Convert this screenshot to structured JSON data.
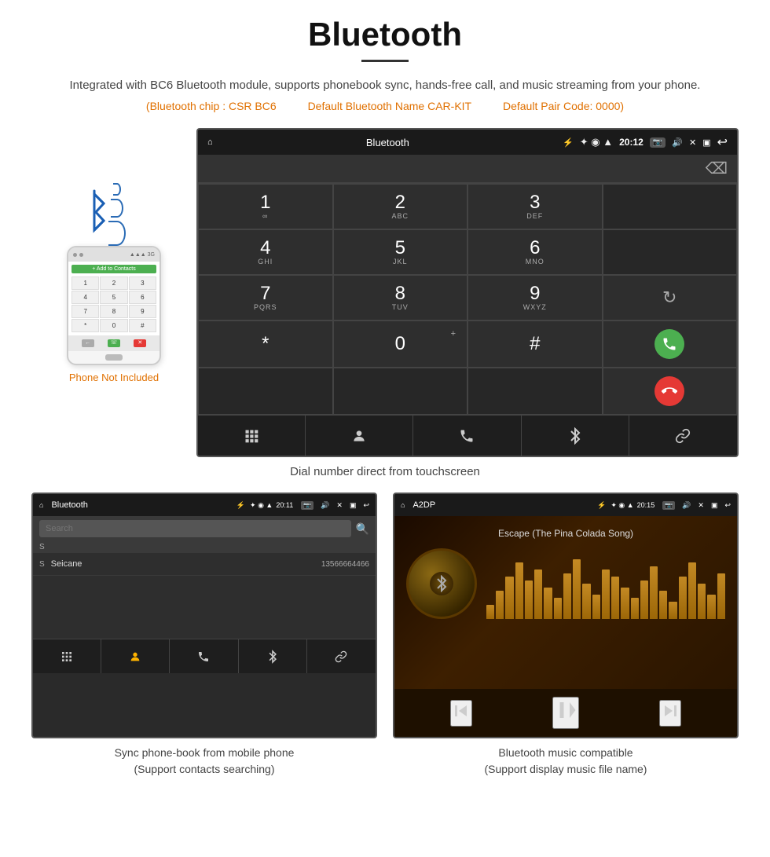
{
  "page": {
    "title": "Bluetooth",
    "description": "Integrated with BC6 Bluetooth module, supports phonebook sync, hands-free call, and music streaming from your phone.",
    "specs": {
      "chip": "(Bluetooth chip : CSR BC6",
      "name": "Default Bluetooth Name CAR-KIT",
      "pair_code": "Default Pair Code: 0000)"
    },
    "main_caption": "Dial number direct from touchscreen",
    "bottom_left_caption_line1": "Sync phone-book from mobile phone",
    "bottom_left_caption_line2": "(Support contacts searching)",
    "bottom_right_caption_line1": "Bluetooth music compatible",
    "bottom_right_caption_line2": "(Support display music file name)"
  },
  "phone_label": "Phone Not Included",
  "android_dial": {
    "status_bar": {
      "home": "⌂",
      "title": "Bluetooth",
      "usb_icon": "⚡",
      "bt_icon": "✦",
      "location": "◉",
      "signal": "▲",
      "time": "20:12",
      "camera_icon": "📷",
      "volume_icon": "🔊",
      "close_icon": "✕",
      "window_icon": "▣",
      "back_icon": "↩"
    },
    "keys": [
      {
        "num": "1",
        "sub": "∞",
        "letters": ""
      },
      {
        "num": "2",
        "sub": "",
        "letters": "ABC"
      },
      {
        "num": "3",
        "sub": "",
        "letters": "DEF"
      },
      {
        "num": "",
        "sub": "",
        "letters": ""
      },
      {
        "num": "4",
        "sub": "",
        "letters": "GHI"
      },
      {
        "num": "5",
        "sub": "",
        "letters": "JKL"
      },
      {
        "num": "6",
        "sub": "",
        "letters": "MNO"
      },
      {
        "num": "",
        "sub": "",
        "letters": ""
      },
      {
        "num": "7",
        "sub": "",
        "letters": "PQRS"
      },
      {
        "num": "8",
        "sub": "",
        "letters": "TUV"
      },
      {
        "num": "9",
        "sub": "",
        "letters": "WXYZ"
      },
      {
        "num": "↻",
        "sub": "",
        "letters": ""
      },
      {
        "num": "*",
        "sub": "",
        "letters": ""
      },
      {
        "num": "0",
        "sub": "+",
        "letters": ""
      },
      {
        "num": "#",
        "sub": "",
        "letters": ""
      },
      {
        "num": "call",
        "sub": "",
        "letters": ""
      },
      {
        "num": "end",
        "sub": "",
        "letters": ""
      }
    ],
    "bottom_bar": [
      "⊞",
      "♟",
      "☏",
      "✦",
      "🔗"
    ]
  },
  "phonebook_screen": {
    "title": "Bluetooth",
    "time": "20:11",
    "search_placeholder": "Search",
    "letter_header": "S",
    "contact_name": "Seicane",
    "contact_number": "13566664466",
    "bottom_bar": [
      "⊞",
      "♟",
      "☏",
      "✦",
      "🔗"
    ]
  },
  "music_screen": {
    "title": "A2DP",
    "time": "20:15",
    "song_title": "Escape (The Pina Colada Song)",
    "eq_bars": [
      20,
      40,
      60,
      80,
      55,
      70,
      45,
      30,
      65,
      85,
      50,
      35,
      70,
      60,
      45,
      30,
      55,
      75,
      40,
      25,
      60,
      80,
      50,
      35,
      65
    ],
    "controls": {
      "prev": "⏮",
      "play_pause": "⏯",
      "next": "⏭"
    }
  }
}
